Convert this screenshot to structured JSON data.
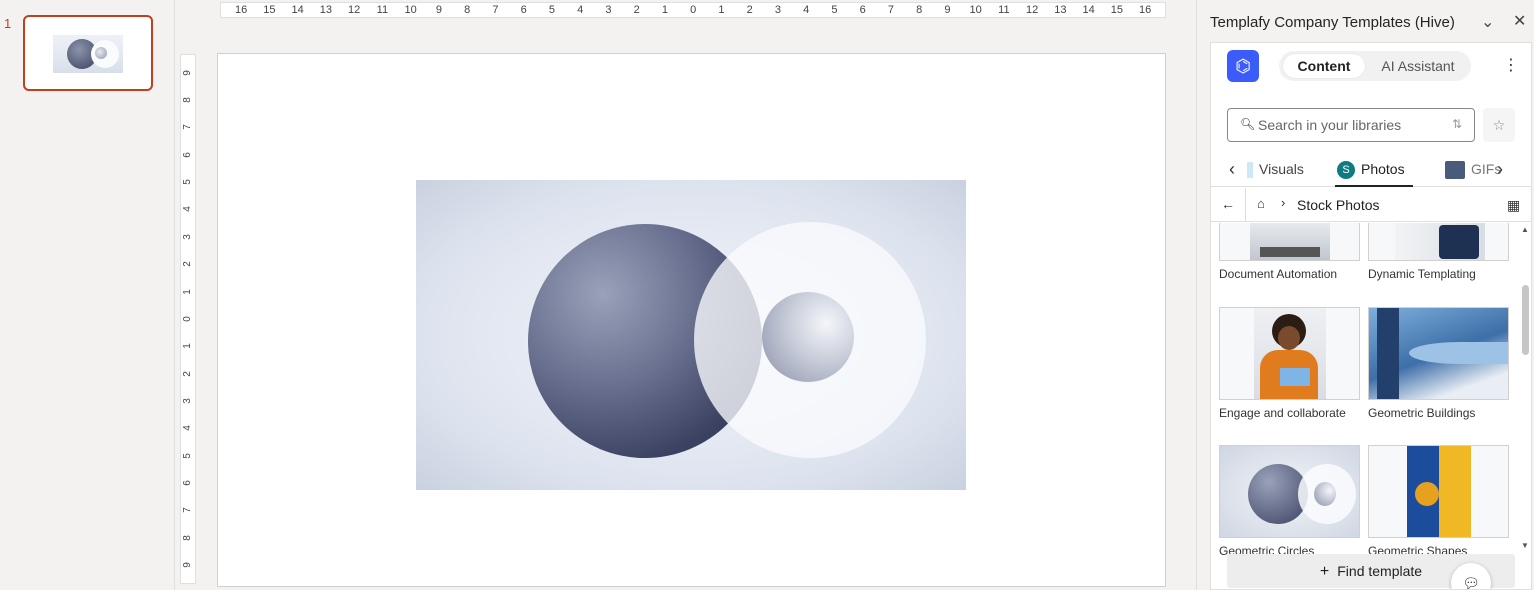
{
  "thumbnails": {
    "slide_number": "1"
  },
  "rulers": {
    "horizontal": [
      "16",
      "15",
      "14",
      "13",
      "12",
      "11",
      "10",
      "9",
      "8",
      "7",
      "6",
      "5",
      "4",
      "3",
      "2",
      "1",
      "0",
      "1",
      "2",
      "3",
      "4",
      "5",
      "6",
      "7",
      "8",
      "9",
      "10",
      "11",
      "12",
      "13",
      "14",
      "15",
      "16"
    ],
    "vertical": [
      "9",
      "8",
      "7",
      "6",
      "5",
      "4",
      "3",
      "2",
      "1",
      "0",
      "1",
      "2",
      "3",
      "4",
      "5",
      "6",
      "7",
      "8",
      "9"
    ]
  },
  "panel": {
    "title": "Templafy Company Templates (Hive)",
    "tabs": {
      "content": "Content",
      "ai": "AI Assistant"
    },
    "search": {
      "placeholder": "Search in your libraries"
    },
    "categories": {
      "visuals": "Visuals",
      "photos": "Photos",
      "gif": "GIFs"
    },
    "breadcrumb": "Stock Photos",
    "cards": [
      {
        "caption": "Document Automation"
      },
      {
        "caption": "Dynamic Templating"
      },
      {
        "caption": "Engage and collaborate"
      },
      {
        "caption": "Geometric Buildings"
      },
      {
        "caption": "Geometric Circles"
      },
      {
        "caption": "Geometric Shapes"
      }
    ],
    "find_button": "Find template"
  },
  "icons": {
    "logo": "templafy-logo-icon",
    "chat": "chat-icon"
  },
  "colors": {
    "accent": "#c43e1c",
    "brand": "#3b5bfb"
  }
}
